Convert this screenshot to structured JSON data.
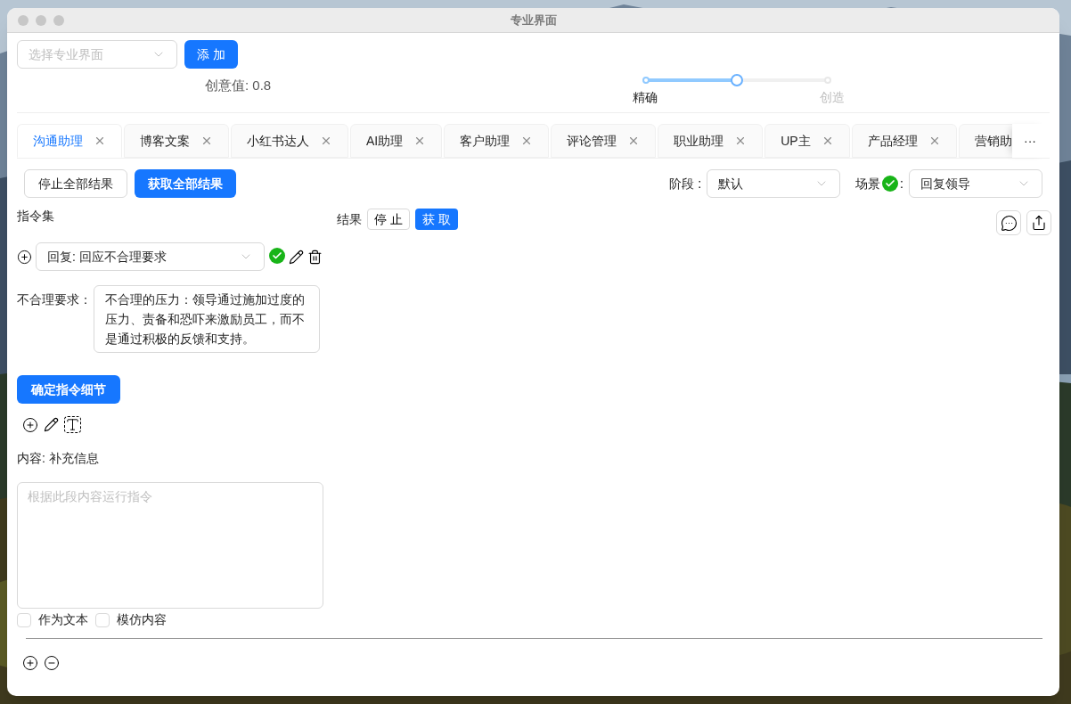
{
  "window": {
    "title": "专业界面"
  },
  "toolbar": {
    "select_placeholder": "选择专业界面",
    "add_button": "添 加"
  },
  "creativity": {
    "label": "创意值: 0.8",
    "level": 0.5,
    "left_label": "精确",
    "right_label": "创造"
  },
  "tabs": [
    {
      "label": "沟通助理",
      "selected": true
    },
    {
      "label": "博客文案",
      "selected": false
    },
    {
      "label": "小红书达人",
      "selected": false
    },
    {
      "label": "AI助理",
      "selected": false
    },
    {
      "label": "客户助理",
      "selected": false
    },
    {
      "label": "评论管理",
      "selected": false
    },
    {
      "label": "职业助理",
      "selected": false
    },
    {
      "label": "UP主",
      "selected": false
    },
    {
      "label": "产品经理",
      "selected": false
    },
    {
      "label": "营销助",
      "selected": false
    }
  ],
  "tabs_more": "···",
  "actions": {
    "stop_all": "停止全部结果",
    "fetch_all": "获取全部结果"
  },
  "stage": {
    "label": "阶段",
    "colon": ":",
    "value": "默认"
  },
  "scene": {
    "label": "场景",
    "verified": true,
    "colon": ":",
    "value": "回复领导"
  },
  "instructions": {
    "title": "指令集",
    "select_value": "回复: 回应不合理要求",
    "verified": true,
    "field_label": "不合理要求：",
    "field_value": "不合理的压力：领导通过施加过度的压力、责备和恐吓来激励员工，而不是通过积极的反馈和支持。",
    "confirm_button": "确定指令细节"
  },
  "results": {
    "label": "结果",
    "stop": "停 止",
    "fetch": "获 取"
  },
  "content": {
    "label": "内容: 补充信息",
    "placeholder": "根据此段内容运行指令",
    "checkboxes": [
      {
        "label": "作为文本",
        "checked": false
      },
      {
        "label": "模仿内容",
        "checked": false
      }
    ]
  }
}
